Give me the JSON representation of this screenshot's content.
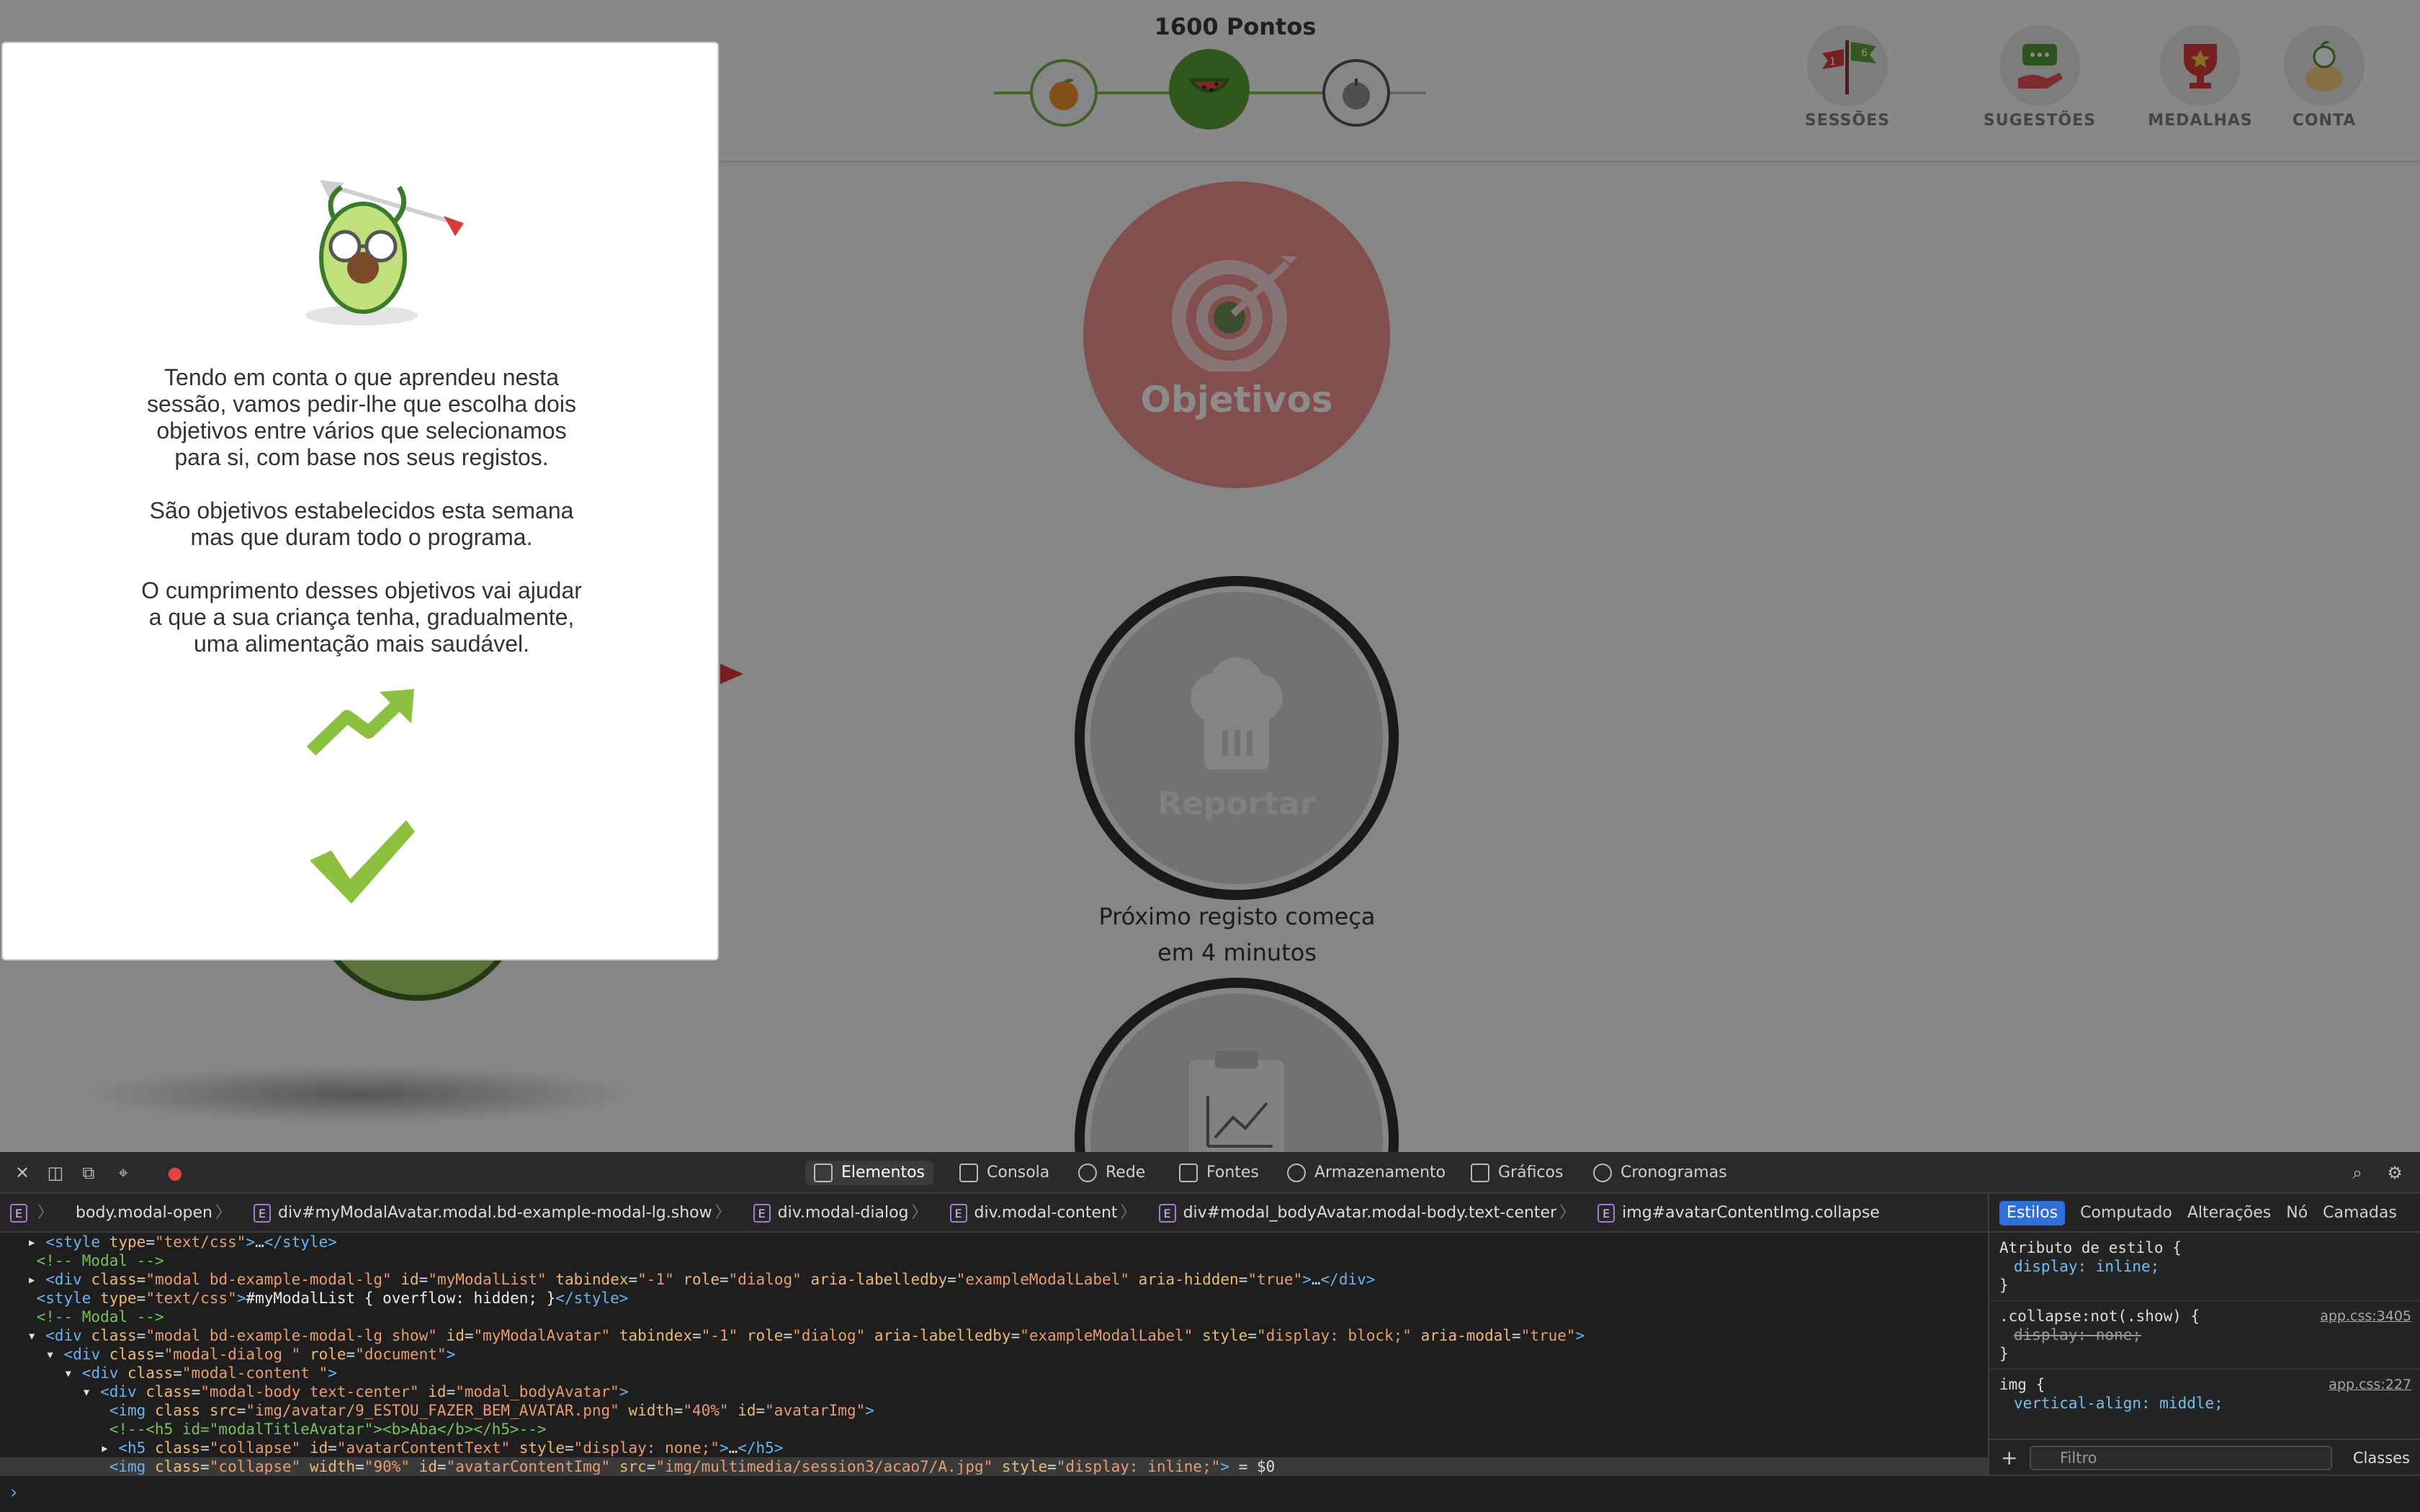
{
  "header": {
    "points": "1600 Pontos",
    "nav": [
      {
        "label": "SESSÕES",
        "icon": "flags-icon",
        "badges": [
          "1",
          "6"
        ]
      },
      {
        "label": "SUGESTÕES",
        "icon": "chat-hand-icon"
      },
      {
        "label": "MEDALHAS",
        "icon": "medal-cup-icon"
      },
      {
        "label": "CONTA",
        "icon": "account-icon"
      }
    ]
  },
  "main": {
    "objectives_label": "Objetivos",
    "report_label": "Reportar",
    "next_register": "Próximo registo começa\nem 4 minutos"
  },
  "modal": {
    "paragraph1": "Tendo em conta o que aprendeu nesta\nsessão, vamos pedir-lhe que escolha dois\nobjetivos entre vários que selecionamos\npara si, com base nos seus registos.",
    "paragraph2": "São objetivos estabelecidos esta semana\nmas que duram todo o programa.",
    "paragraph3": "O cumprimento desses objetivos vai ajudar\na que a sua criança tenha, gradualmente,\numa alimentação mais saudável."
  },
  "devtools": {
    "tabs": [
      "Elementos",
      "Consola",
      "Rede",
      "Fontes",
      "Armazenamento",
      "Gráficos",
      "Cronogramas"
    ],
    "breadcrumbs": [
      "body.modal-open",
      "div#myModalAvatar.modal.bd-example-modal-lg.show",
      "div.modal-dialog",
      "div.modal-content",
      "div#modal_bodyAvatar.modal-body.text-center",
      "img#avatarContentImg.collapse"
    ],
    "sidebar_tabs": [
      "Estilos",
      "Computado",
      "Alterações",
      "Nó",
      "Camadas"
    ],
    "filter_placeholder": "Filtro",
    "classes_label": "Classes",
    "styles": {
      "rule1_selector": "Atributo de estilo {",
      "rule1_prop": "display: inline;",
      "rule2_selector": ".collapse:not(.show) {",
      "rule2_prop": "display: none;",
      "rule2_src": "app.css:3405",
      "rule3_selector": "img {",
      "rule3_prop": "vertical-align: middle;",
      "rule3_src": "app.css:227",
      "close_brace": "}"
    }
  },
  "colors": {
    "accent_green": "#88b64b",
    "objectives_red": "#ee8e8e",
    "devtools_bg": "#1e1e1e"
  }
}
